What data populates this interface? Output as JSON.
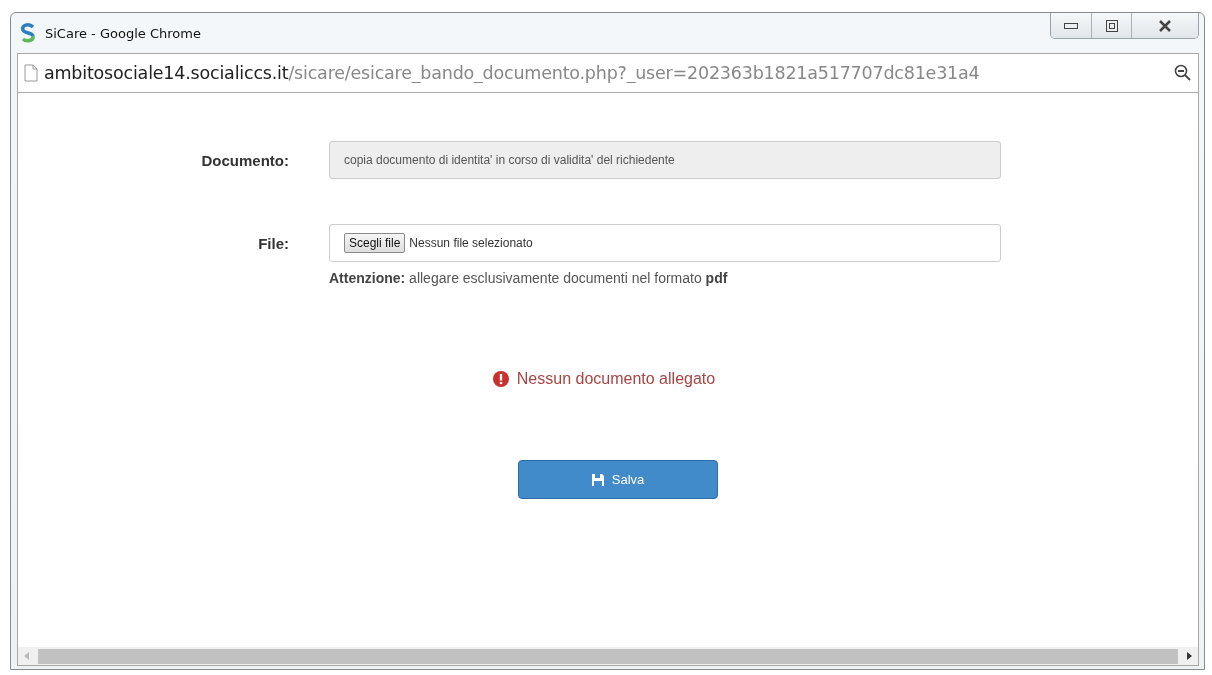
{
  "window": {
    "title": "SiCare - Google Chrome"
  },
  "address_bar": {
    "host": "ambitosociale14.socialiccs.it",
    "path": "/sicare/esicare_bando_documento.php?_user=202363b1821a517707dc81e31a4"
  },
  "form": {
    "document_label": "Documento:",
    "document_value": "copia documento di identita' in corso di validita' del richiedente",
    "file_label": "File:",
    "file_button": "Scegli file",
    "file_status": "Nessun file selezionato",
    "note": "**Attenzione:** allegare esclusivamente documenti nel formato **pdf**"
  },
  "alert": {
    "kind": "error",
    "text": "Nessun documento allegato"
  },
  "save_button": {
    "label": "Salva"
  }
}
